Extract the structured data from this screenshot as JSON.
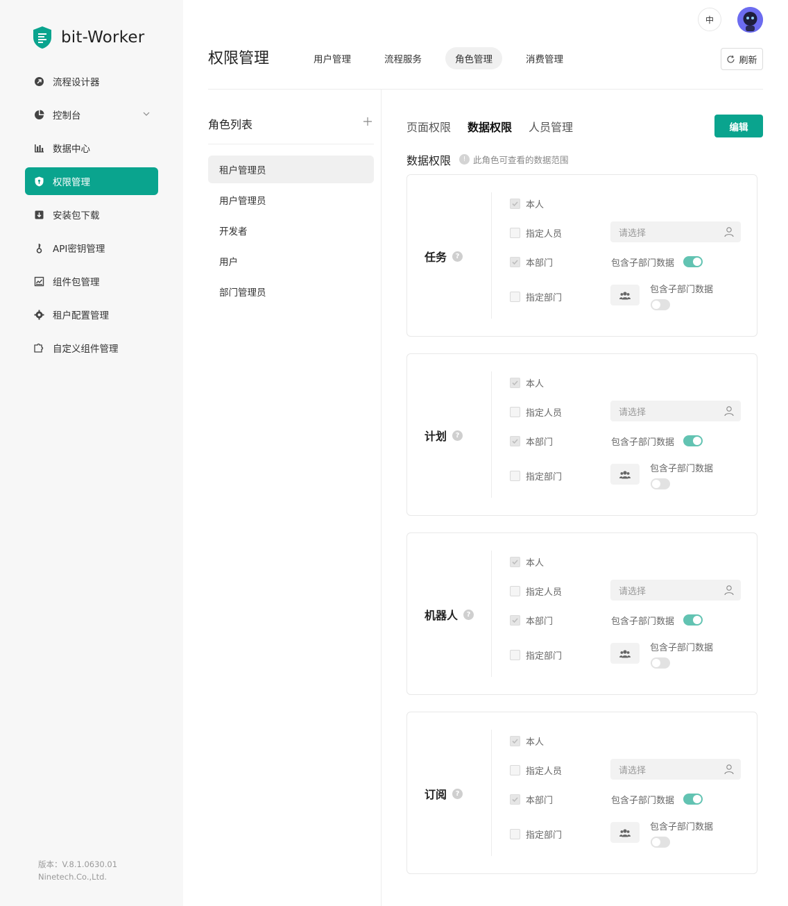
{
  "app": {
    "name": "bit-Worker"
  },
  "sidebar": {
    "items": [
      {
        "label": "流程设计器",
        "icon": "flow-designer-icon"
      },
      {
        "label": "控制台",
        "icon": "console-icon"
      },
      {
        "label": "数据中心",
        "icon": "data-center-icon"
      },
      {
        "label": "权限管理",
        "icon": "shield-icon"
      },
      {
        "label": "安装包下载",
        "icon": "download-icon"
      },
      {
        "label": "API密钥管理",
        "icon": "key-icon"
      },
      {
        "label": "组件包管理",
        "icon": "package-icon"
      },
      {
        "label": "租户配置管理",
        "icon": "gear-icon"
      },
      {
        "label": "自定义组件管理",
        "icon": "puzzle-icon"
      }
    ],
    "active_index": 3,
    "version_line1": "版本：V.8.1.0630.01",
    "version_line2": "Ninetech.Co.,Ltd."
  },
  "header": {
    "lang": "中",
    "page_title": "权限管理",
    "tabs": [
      "用户管理",
      "流程服务",
      "角色管理",
      "消费管理"
    ],
    "active_tab": 2,
    "refresh_label": "刷新"
  },
  "roles": {
    "title": "角色列表",
    "items": [
      "租户管理员",
      "用户管理员",
      "开发者",
      "用户",
      "部门管理员"
    ],
    "active_index": 0
  },
  "detail": {
    "tabs": [
      "页面权限",
      "数据权限",
      "人员管理"
    ],
    "active_tab": 1,
    "edit_label": "编辑",
    "section_title": "数据权限",
    "section_hint": "此角色可查看的数据范围",
    "options": {
      "self": "本人",
      "specified_people": "指定人员",
      "own_dept": "本部门",
      "specified_dept": "指定部门",
      "select_placeholder": "请选择",
      "include_sub": "包含子部门数据"
    },
    "cards": [
      {
        "title": "任务",
        "self": true,
        "specified_people": false,
        "own_dept": true,
        "own_dept_include_sub": true,
        "specified_dept": false,
        "specified_dept_include_sub": false
      },
      {
        "title": "计划",
        "self": true,
        "specified_people": false,
        "own_dept": true,
        "own_dept_include_sub": true,
        "specified_dept": false,
        "specified_dept_include_sub": false
      },
      {
        "title": "机器人",
        "self": true,
        "specified_people": false,
        "own_dept": true,
        "own_dept_include_sub": true,
        "specified_dept": false,
        "specified_dept_include_sub": false
      },
      {
        "title": "订阅",
        "self": true,
        "specified_people": false,
        "own_dept": true,
        "own_dept_include_sub": true,
        "specified_dept": false,
        "specified_dept_include_sub": false
      }
    ]
  },
  "colors": {
    "accent": "#0aa48e",
    "toggle_on": "#62c3b2",
    "sidebar_bg": "#f7f7f7"
  }
}
